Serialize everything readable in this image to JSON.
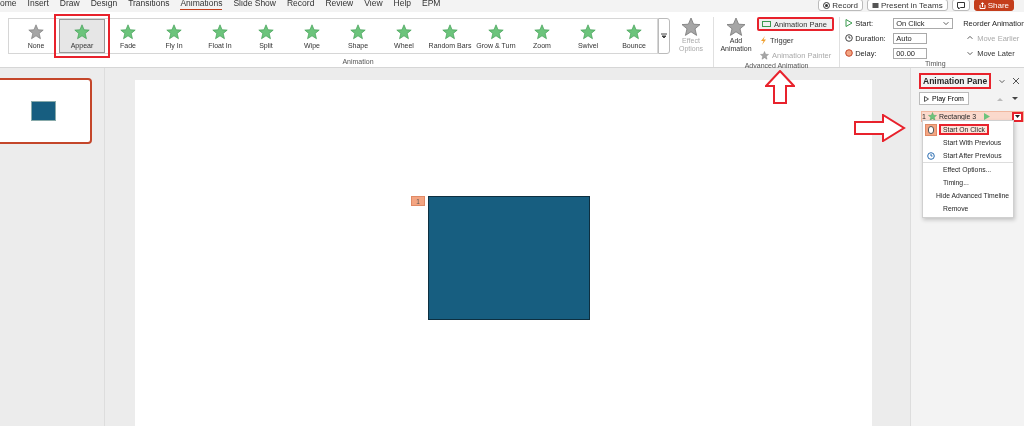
{
  "menu_tabs": [
    {
      "label": "ome",
      "selected": false
    },
    {
      "label": "Insert",
      "selected": false
    },
    {
      "label": "Draw",
      "selected": false
    },
    {
      "label": "Design",
      "selected": false
    },
    {
      "label": "Transitions",
      "selected": false
    },
    {
      "label": "Animations",
      "selected": true
    },
    {
      "label": "Slide Show",
      "selected": false
    },
    {
      "label": "Record",
      "selected": false
    },
    {
      "label": "Review",
      "selected": false
    },
    {
      "label": "View",
      "selected": false
    },
    {
      "label": "Help",
      "selected": false
    },
    {
      "label": "EPM",
      "selected": false
    }
  ],
  "title_buttons": [
    {
      "kind": "record",
      "label": "Record"
    },
    {
      "kind": "teams",
      "label": "Present in Teams"
    },
    {
      "kind": "comment"
    },
    {
      "kind": "share",
      "label": "Share"
    }
  ],
  "animation_group": {
    "label": "Animation",
    "effects": [
      {
        "label": "None",
        "kind": "none",
        "selected": false,
        "highlighted": false
      },
      {
        "label": "Appear",
        "kind": "effect",
        "selected": true,
        "highlighted": true
      },
      {
        "label": "Fade",
        "kind": "effect",
        "selected": false,
        "highlighted": false
      },
      {
        "label": "Fly In",
        "kind": "effect",
        "selected": false,
        "highlighted": false
      },
      {
        "label": "Float In",
        "kind": "effect",
        "selected": false,
        "highlighted": false
      },
      {
        "label": "Split",
        "kind": "effect",
        "selected": false,
        "highlighted": false
      },
      {
        "label": "Wipe",
        "kind": "effect",
        "selected": false,
        "highlighted": false
      },
      {
        "label": "Shape",
        "kind": "effect",
        "selected": false,
        "highlighted": false
      },
      {
        "label": "Wheel",
        "kind": "effect",
        "selected": false,
        "highlighted": false
      },
      {
        "label": "Random Bars",
        "kind": "effect",
        "selected": false,
        "highlighted": false
      },
      {
        "label": "Grow & Turn",
        "kind": "effect",
        "selected": false,
        "highlighted": false
      },
      {
        "label": "Zoom",
        "kind": "effect",
        "selected": false,
        "highlighted": false
      },
      {
        "label": "Swivel",
        "kind": "effect",
        "selected": false,
        "highlighted": false
      },
      {
        "label": "Bounce",
        "kind": "effect",
        "selected": false,
        "highlighted": false
      }
    ],
    "effect_options": {
      "label": "Effect Options",
      "disabled": true
    }
  },
  "advanced_group": {
    "label": "Advanced Animation",
    "add_animation": "Add Animation",
    "animation_pane": {
      "label": "Animation Pane",
      "highlighted": true
    },
    "trigger": {
      "label": "Trigger",
      "disabled": false
    },
    "painter": {
      "label": "Animation Painter",
      "disabled": true
    }
  },
  "timing_group": {
    "label": "Timing",
    "start": {
      "label": "Start:",
      "value": "On Click"
    },
    "duration": {
      "label": "Duration:",
      "value": "Auto"
    },
    "delay": {
      "label": "Delay:",
      "value": "00.00"
    }
  },
  "reorder": {
    "title": "Reorder Animation",
    "buttons": [
      {
        "label": "Move Earlier",
        "kind": "up",
        "disabled": true
      },
      {
        "label": "Move Later",
        "kind": "down",
        "disabled": false
      }
    ]
  },
  "slides": [
    {
      "selected": true
    }
  ],
  "slide": {
    "tag": "1"
  },
  "pane": {
    "title": "Animation Pane",
    "title_highlighted": true,
    "play_from": "Play From",
    "items": [
      {
        "number": "1",
        "label": "Rectangle 3",
        "selected": true,
        "dropdown_highlighted": true
      }
    ],
    "menu": [
      {
        "items": [
          {
            "label": "Start On Click",
            "kind": "mouse",
            "checked": true,
            "highlighted": true
          },
          {
            "label": "Start With Previous",
            "kind": "plain",
            "checked": false,
            "highlighted": false
          },
          {
            "label": "Start After Previous",
            "kind": "clock",
            "checked": false,
            "highlighted": false
          }
        ]
      },
      {
        "items": [
          {
            "label": "Effect Options...",
            "kind": "plain",
            "checked": false,
            "highlighted": false
          },
          {
            "label": "Timing...",
            "kind": "plain",
            "checked": false,
            "highlighted": false
          },
          {
            "label": "Hide Advanced Timeline",
            "kind": "plain",
            "checked": false,
            "highlighted": false
          },
          {
            "label": "Remove",
            "kind": "plain",
            "checked": false,
            "highlighted": false
          }
        ]
      }
    ]
  }
}
